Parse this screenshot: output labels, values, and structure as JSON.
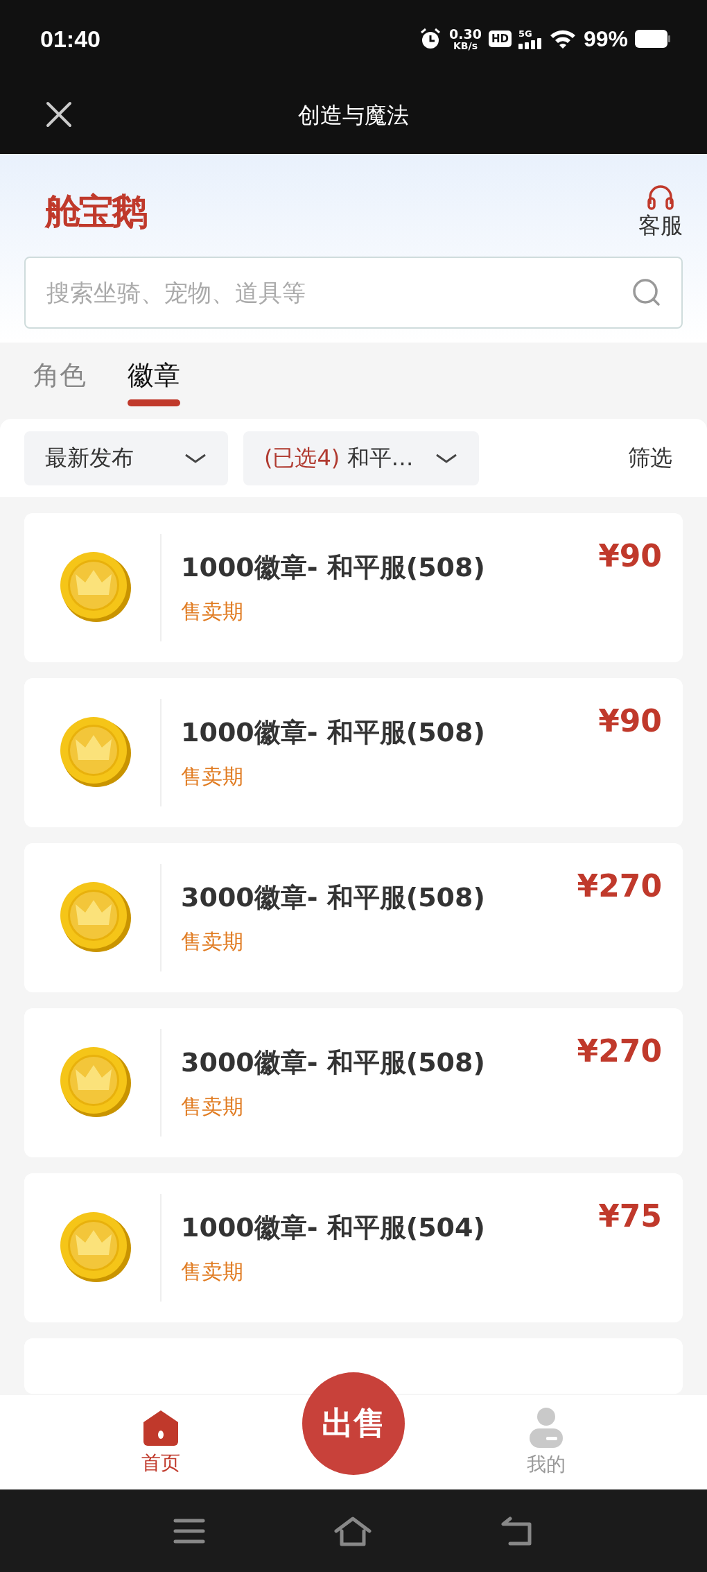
{
  "status_bar": {
    "time": "01:40",
    "net_speed": "0.30",
    "net_unit": "KB/s",
    "hd": "HD",
    "network": "5G",
    "battery": "99%"
  },
  "title_bar": {
    "title": "创造与魔法"
  },
  "header": {
    "logo": "舱宝鹅",
    "service": "客服"
  },
  "search": {
    "placeholder": "搜索坐骑、宠物、道具等"
  },
  "tabs": [
    {
      "label": "角色",
      "selected": false
    },
    {
      "label": "徽章",
      "selected": true
    }
  ],
  "filters": [
    {
      "kind": "sort",
      "label": "最新发布"
    },
    {
      "kind": "multi",
      "count_label": "(已选4)",
      "label": "和平…"
    },
    {
      "kind": "text",
      "label": "筛选"
    }
  ],
  "listings": [
    {
      "title": "1000徽章- 和平服(508)",
      "tag": "售卖期",
      "price": "¥90"
    },
    {
      "title": "1000徽章- 和平服(508)",
      "tag": "售卖期",
      "price": "¥90"
    },
    {
      "title": "3000徽章- 和平服(508)",
      "tag": "售卖期",
      "price": "¥270"
    },
    {
      "title": "3000徽章- 和平服(508)",
      "tag": "售卖期",
      "price": "¥270"
    },
    {
      "title": "1000徽章- 和平服(504)",
      "tag": "售卖期",
      "price": "¥75"
    }
  ],
  "sell_button": {
    "label": "出售"
  },
  "bottom_nav": [
    {
      "kind": "home",
      "label": "首页",
      "selected": true
    },
    {
      "kind": "me",
      "label": "我的",
      "selected": false
    }
  ]
}
